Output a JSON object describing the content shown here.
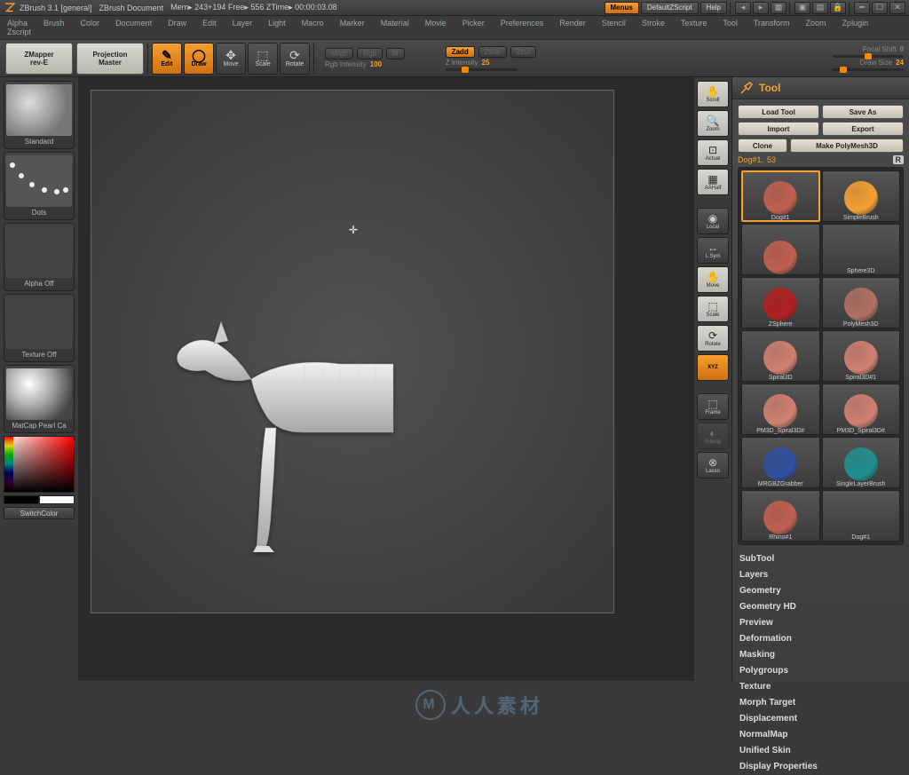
{
  "title": {
    "app": "ZBrush 3.1 [general]",
    "doc": "ZBrush Document",
    "mem": "Mem▸ 243+194  Free▸ 556  ZTime▸ 00:00:03.08",
    "menus": "Menus",
    "script": "DefaultZScript",
    "help": "Help"
  },
  "menu": [
    "Alpha",
    "Brush",
    "Color",
    "Document",
    "Draw",
    "Edit",
    "Layer",
    "Light",
    "Macro",
    "Marker",
    "Material",
    "Movie",
    "Picker",
    "Preferences",
    "Render",
    "Stencil",
    "Stroke",
    "Texture",
    "Tool",
    "Transform",
    "Zoom",
    "Zplugin",
    "Zscript"
  ],
  "toolbar": {
    "zmapper": "ZMapper\nrev-E",
    "projmaster": "Projection\nMaster",
    "modes": [
      {
        "label": "Edit",
        "active": true
      },
      {
        "label": "Draw",
        "active": true
      },
      {
        "label": "Move",
        "active": false
      },
      {
        "label": "Scale",
        "active": false
      },
      {
        "label": "Rotate",
        "active": false
      }
    ],
    "rgb_modes": [
      {
        "label": "Mrgb",
        "active": false
      },
      {
        "label": "Rgb",
        "active": false
      },
      {
        "label": "M",
        "active": false
      }
    ],
    "rgb_intensity_label": "Rgb Intensity",
    "rgb_intensity_val": "100",
    "z_modes": [
      {
        "label": "Zadd",
        "active": true
      },
      {
        "label": "Zsub",
        "active": false
      },
      {
        "label": "Zcut",
        "active": false
      }
    ],
    "z_intensity_label": "Z Intensity",
    "z_intensity_val": "25",
    "focal_label": "Focal Shift",
    "focal_val": "0",
    "draw_label": "Draw Size",
    "draw_val": "24"
  },
  "left": {
    "brush": "Standard",
    "stroke": "Dots",
    "alpha": "Alpha Off",
    "texture": "Texture Off",
    "material": "MatCap Pearl Ca",
    "switch": "SwitchColor"
  },
  "right_ctrl": [
    "Scroll",
    "Zoom",
    "Actual",
    "AAHalf",
    "",
    "Local",
    "L.Sym",
    "Move",
    "Scale",
    "Rotate",
    "XYZ",
    "",
    "Frame",
    "Transp",
    "Lasso"
  ],
  "tool": {
    "title": "Tool",
    "buttons1": [
      "Load Tool",
      "Save As"
    ],
    "buttons2": [
      "Import",
      "Export"
    ],
    "buttons3": [
      "Clone",
      "Make PolyMesh3D"
    ],
    "item_name": "Dog#1.",
    "item_suffix": "53",
    "r": "R",
    "grid": [
      "Dog#1",
      "SimpleBrush",
      "",
      "Sphere3D",
      "ZSphere",
      "PolyMesh3D",
      "Spiral3D",
      "Spiral3D#1",
      "PM3D_Spiral3D#",
      "PM3D_Spiral3D#",
      "MRGBZGrabber",
      "SingleLayerBrush",
      "Rhino#1",
      "Dog#1"
    ],
    "sections": [
      "SubTool",
      "Layers",
      "Geometry",
      "Geometry HD",
      "Preview",
      "Deformation",
      "Masking",
      "Polygroups",
      "Texture",
      "Morph Target",
      "Displacement",
      "NormalMap",
      "Unified Skin",
      "Display Properties"
    ]
  },
  "watermark": "人人素材"
}
